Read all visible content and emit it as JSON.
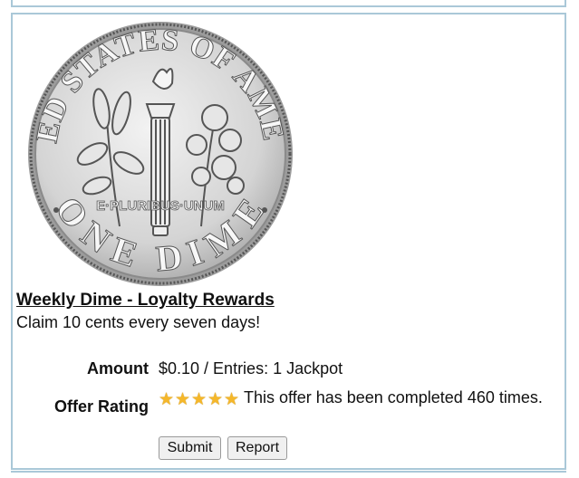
{
  "offer": {
    "title": "Weekly Dime - Loyalty Rewards",
    "description": "Claim 10 cents every seven days!",
    "amount_label": "Amount",
    "amount_value": "$0.10 / Entries: 1 Jackpot",
    "rating_label": "Offer Rating",
    "rating_stars": 5,
    "rating_text": "This offer has been completed 460 times.",
    "submit_label": "Submit",
    "report_label": "Report"
  },
  "coin": {
    "top_text": "UNITED STATES OF AMERICA",
    "motto": "E·PLURIBUS·UNUM",
    "bottom_text": "ONE DIME"
  },
  "colors": {
    "panel_border": "#aac8d8",
    "star": "#f5b72a",
    "coin_face": "#d8d8d8"
  }
}
